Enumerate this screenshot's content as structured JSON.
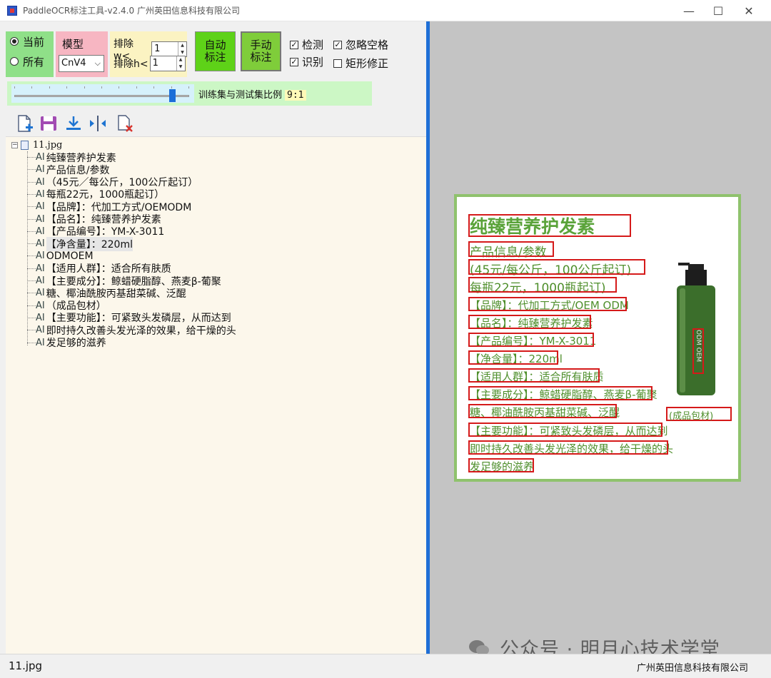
{
  "window": {
    "title": "PaddleOCR标注工具-v2.4.0 广州英田信息科技有限公司",
    "minimize": "—",
    "maximize": "☐",
    "close": "✕"
  },
  "scope": {
    "current": "当前",
    "all": "所有",
    "selected": "current"
  },
  "model": {
    "label": "模型",
    "value": "CnV4"
  },
  "exclude": {
    "w_label": "排除w<",
    "w_value": "1",
    "h_label": "排除h<",
    "h_value": "1"
  },
  "buttons": {
    "auto_label": "自动标注",
    "auto_line1": "自动",
    "auto_line2": "标注",
    "manual_line1": "手动",
    "manual_line2": "标注"
  },
  "options": {
    "detect": {
      "label": "检测",
      "checked": true
    },
    "ignore_space": {
      "label": "忽略空格",
      "checked": true
    },
    "recognize": {
      "label": "识别",
      "checked": true
    },
    "rect_fix": {
      "label": "矩形修正",
      "checked": false
    }
  },
  "split": {
    "label": "训练集与测试集比例",
    "value": "9:1",
    "slider_fraction": 0.9
  },
  "toolbar": [
    "new-file-icon",
    "save-icon",
    "download-icon",
    "split-icon",
    "delete-file-icon"
  ],
  "tree": {
    "root": "11.jpg",
    "items": [
      "纯臻营养护发素",
      "产品信息/参数",
      "（45元／每公斤，100公斤起订）",
      "每瓶22元，1000瓶起订）",
      "【品牌】：代加工方式/OEMODM",
      "【品名】：纯臻营养护发素",
      "【产品编号】：YM-X-3011",
      "【净含量】：220ml",
      "ODMOEM",
      "【适用人群】：适合所有肤质",
      "【主要成分】：鲸蜡硬脂醇、燕麦β-葡聚",
      "糖、椰油酰胺丙基甜菜碱、泛醌",
      "（成品包材）",
      "【主要功能】：可紧致头发磷层，从而达到",
      "即时持久改善头发光泽的效果，给干燥的头",
      "发足够的滋养"
    ],
    "item_prefix": "AI",
    "highlighted_index": 7
  },
  "canvas": {
    "headline": "纯臻营养护发素",
    "lines": [
      "产品信息/参数",
      "(45元/每公斤，100公斤起订)",
      "每瓶22元，1000瓶起订)",
      "【品牌】：代加工方式/OEM ODM",
      "【品名】：纯臻营养护发素",
      "【产品编号】：YM-X-3011",
      "【净含量】：220ml",
      "【适用人群】：适合所有肤质",
      "【主要成分】：鲸蜡硬脂醇、燕麦β-葡聚",
      "糖、椰油酰胺丙基甜菜碱、泛醌",
      "【主要功能】：可紧致头发磷层，从而达到",
      "即时持久改善头发光泽的效果，给干燥的头",
      "发足够的滋养"
    ],
    "bottle_label": "ODM OEM",
    "package_label": "(成品包材)"
  },
  "watermark": {
    "text": "公众号 · 明月心技术学堂"
  },
  "status": {
    "left": "11.jpg",
    "right": "广州英田信息科技有限公司"
  },
  "colors": {
    "accent_blue": "#1f6fd6",
    "annotation_red": "#d51a1a",
    "image_border_green": "#8fc26d"
  }
}
